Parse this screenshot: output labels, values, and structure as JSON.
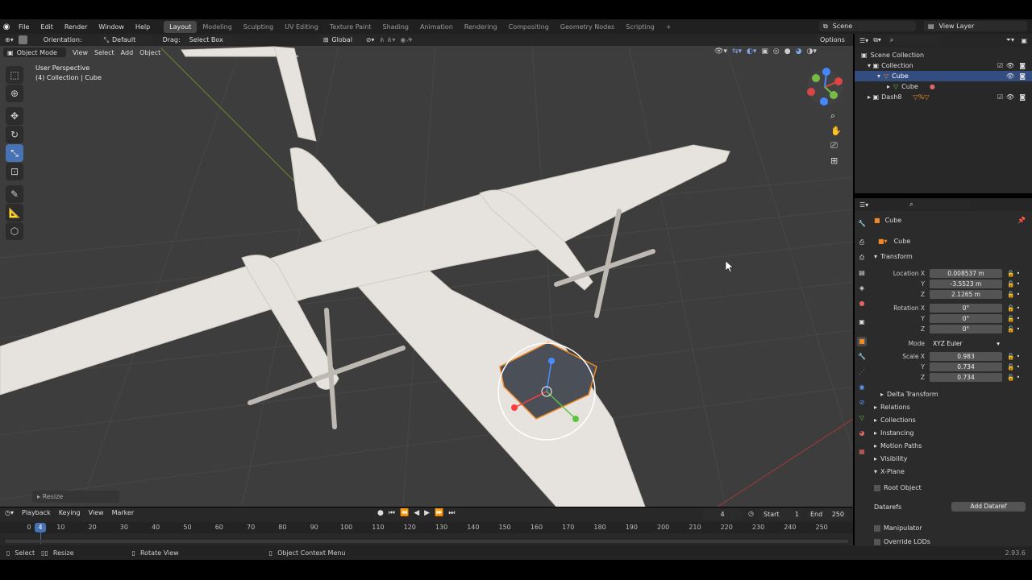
{
  "menu": [
    "File",
    "Edit",
    "Render",
    "Window",
    "Help"
  ],
  "workspaces": [
    "Layout",
    "Modeling",
    "Sculpting",
    "UV Editing",
    "Texture Paint",
    "Shading",
    "Animation",
    "Rendering",
    "Compositing",
    "Geometry Nodes",
    "Scripting"
  ],
  "active_workspace": "Layout",
  "scene": "Scene",
  "view_layer": "View Layer",
  "header": {
    "orientation_label": "Orientation:",
    "orientation_value": "Default",
    "drag_label": "Drag:",
    "drag_value": "Select Box",
    "transform_orientation": "Global",
    "options": "Options"
  },
  "viewport_header": {
    "mode": "Object Mode",
    "menus": [
      "View",
      "Select",
      "Add",
      "Object"
    ]
  },
  "viewport": {
    "perspective": "User Perspective",
    "collection_info": "(4) Collection | Cube",
    "last_op": "Resize"
  },
  "outliner": {
    "root": "Scene Collection",
    "items": [
      {
        "label": "Collection"
      },
      {
        "label": "Cube"
      },
      {
        "label": "Cube"
      },
      {
        "label": "Dash8"
      }
    ]
  },
  "properties": {
    "object_name": "Cube",
    "data_name": "Cube",
    "transform_title": "Transform",
    "location": {
      "label": "Location X",
      "x": "0.008537 m",
      "y": "-3.5523 m",
      "z": "2.1265 m"
    },
    "rotation": {
      "label": "Rotation X",
      "x": "0°",
      "y": "0°",
      "z": "0°"
    },
    "mode_label": "Mode",
    "mode_value": "XYZ Euler",
    "scale": {
      "label": "Scale X",
      "x": "0.983",
      "y": "0.734",
      "z": "0.734"
    },
    "axis_y": "Y",
    "axis_z": "Z",
    "sections": [
      "Delta Transform",
      "Relations",
      "Collections",
      "Instancing",
      "Motion Paths",
      "Visibility",
      "X-Plane"
    ],
    "root_object": "Root Object",
    "datarefs": "Datarefs",
    "add_dataref": "Add Dataref",
    "manipulator": "Manipulator",
    "override_lods": "Override LODs"
  },
  "timeline": {
    "menus": [
      "Playback",
      "Keying",
      "View",
      "Marker"
    ],
    "current_frame": "4",
    "start_label": "Start",
    "start": "1",
    "end_label": "End",
    "end": "250",
    "ruler": [
      "0",
      "10",
      "20",
      "30",
      "40",
      "50",
      "60",
      "70",
      "80",
      "90",
      "100",
      "110",
      "120",
      "130",
      "140",
      "150",
      "160",
      "170",
      "180",
      "190",
      "200",
      "210",
      "220",
      "230",
      "240",
      "250"
    ],
    "playhead": "4"
  },
  "status": {
    "select": "Select",
    "resize": "Resize",
    "rotate": "Rotate View",
    "context": "Object Context Menu",
    "version": "2.93.6"
  },
  "colors": {
    "accent": "#4772b3",
    "selection": "#334d80",
    "orange": "#f08a24",
    "bg_viewport": "#3d3d3d"
  }
}
